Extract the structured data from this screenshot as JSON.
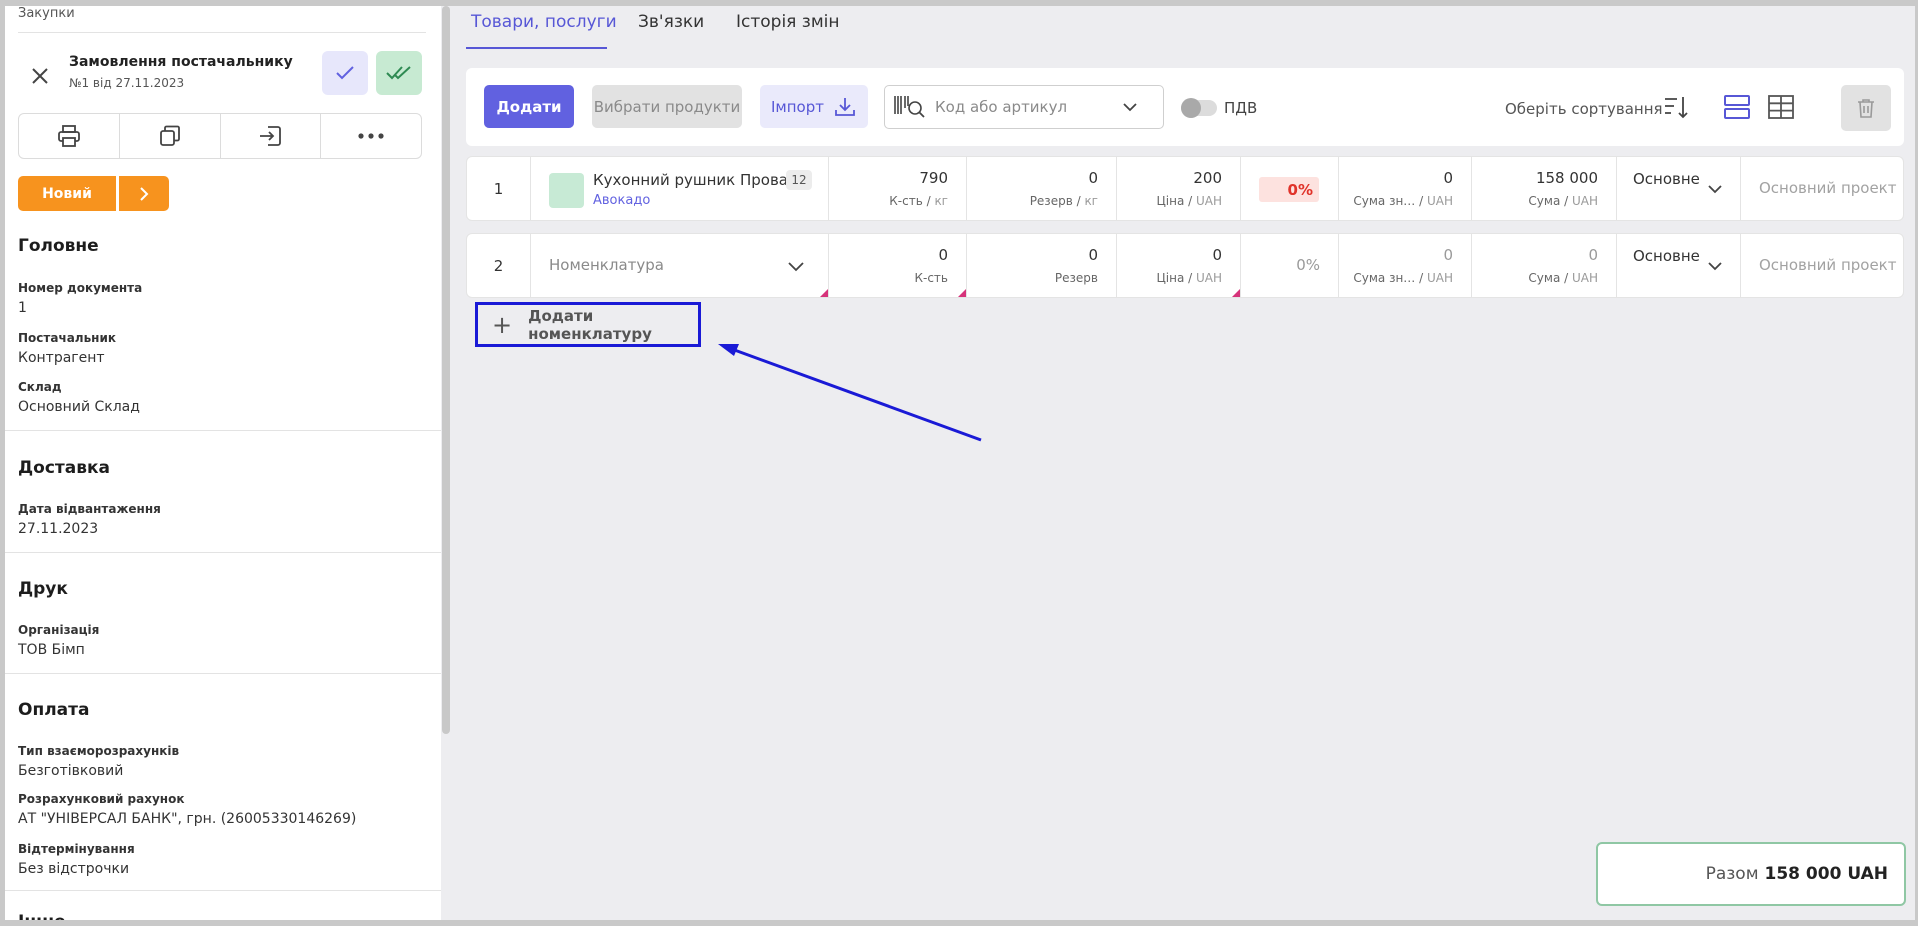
{
  "breadcrumb": "Закупки",
  "document": {
    "title": "Замовлення постачальнику",
    "subtitle": "№1 від 27.11.2023",
    "status": "Новий"
  },
  "sections": {
    "main": {
      "title": "Головне",
      "doc_number_label": "Номер документа",
      "doc_number": "1",
      "supplier_label": "Постачальник",
      "supplier": "Контрагент",
      "warehouse_label": "Склад",
      "warehouse": "Основний Склад"
    },
    "delivery": {
      "title": "Доставка",
      "ship_date_label": "Дата відвантаження",
      "ship_date": "27.11.2023"
    },
    "print": {
      "title": "Друк",
      "org_label": "Організація",
      "org": "ТОВ Бімп"
    },
    "payment": {
      "title": "Оплата",
      "settlement_label": "Тип взаєморозрахунків",
      "settlement": "Безготівковий",
      "account_label": "Розрахунковий рахунок",
      "account": "АТ \"УНІВЕРСАЛ БАНК\", грн. (26005330146269)",
      "deferral_label": "Відтермінування",
      "deferral": "Без відстрочки"
    },
    "other": {
      "title": "Інше"
    }
  },
  "tabs": [
    "Товари, послуги",
    "Зв'язки",
    "Історія змін"
  ],
  "toolbar": {
    "add": "Додати",
    "choose_products": "Вибрати продукти",
    "import": "Імпорт",
    "search_placeholder": "Код або артикул",
    "vat": "ПДВ",
    "sort": "Оберіть сортування"
  },
  "rows": [
    {
      "index": "1",
      "product": "Кухонний рушник Прова…",
      "product_sub": "Авокадо",
      "badge": "12",
      "qty": "790",
      "qty_label": "К-сть",
      "qty_unit": "кг",
      "reserve": "0",
      "reserve_label": "Резерв",
      "reserve_unit": "кг",
      "price": "200",
      "price_label": "Ціна",
      "price_unit": "UAH",
      "discount": "0%",
      "disc_sum": "0",
      "disc_sum_label": "Сума зн…",
      "disc_sum_unit": "UAH",
      "sum": "158 000",
      "sum_label": "Сума",
      "sum_unit": "UAH",
      "type": "Основне",
      "project": "Основний проект"
    },
    {
      "index": "2",
      "product_placeholder": "Номенклатура",
      "qty": "0",
      "qty_label": "К-сть",
      "reserve": "0",
      "reserve_label": "Резерв",
      "price": "0",
      "price_label": "Ціна",
      "price_unit": "UAH",
      "discount": "0%",
      "disc_sum": "0",
      "disc_sum_label": "Сума зн…",
      "disc_sum_unit": "UAH",
      "sum": "0",
      "sum_label": "Сума",
      "sum_unit": "UAH",
      "type": "Основне",
      "project": "Основний проект"
    }
  ],
  "add_nomenclature": "Додати номенклатуру",
  "total": {
    "label": "Разом",
    "value": "158 000 UAH"
  },
  "colors": {
    "accent": "#6161e0",
    "status": "#f7931e",
    "annotation": "#1a1ad6"
  }
}
